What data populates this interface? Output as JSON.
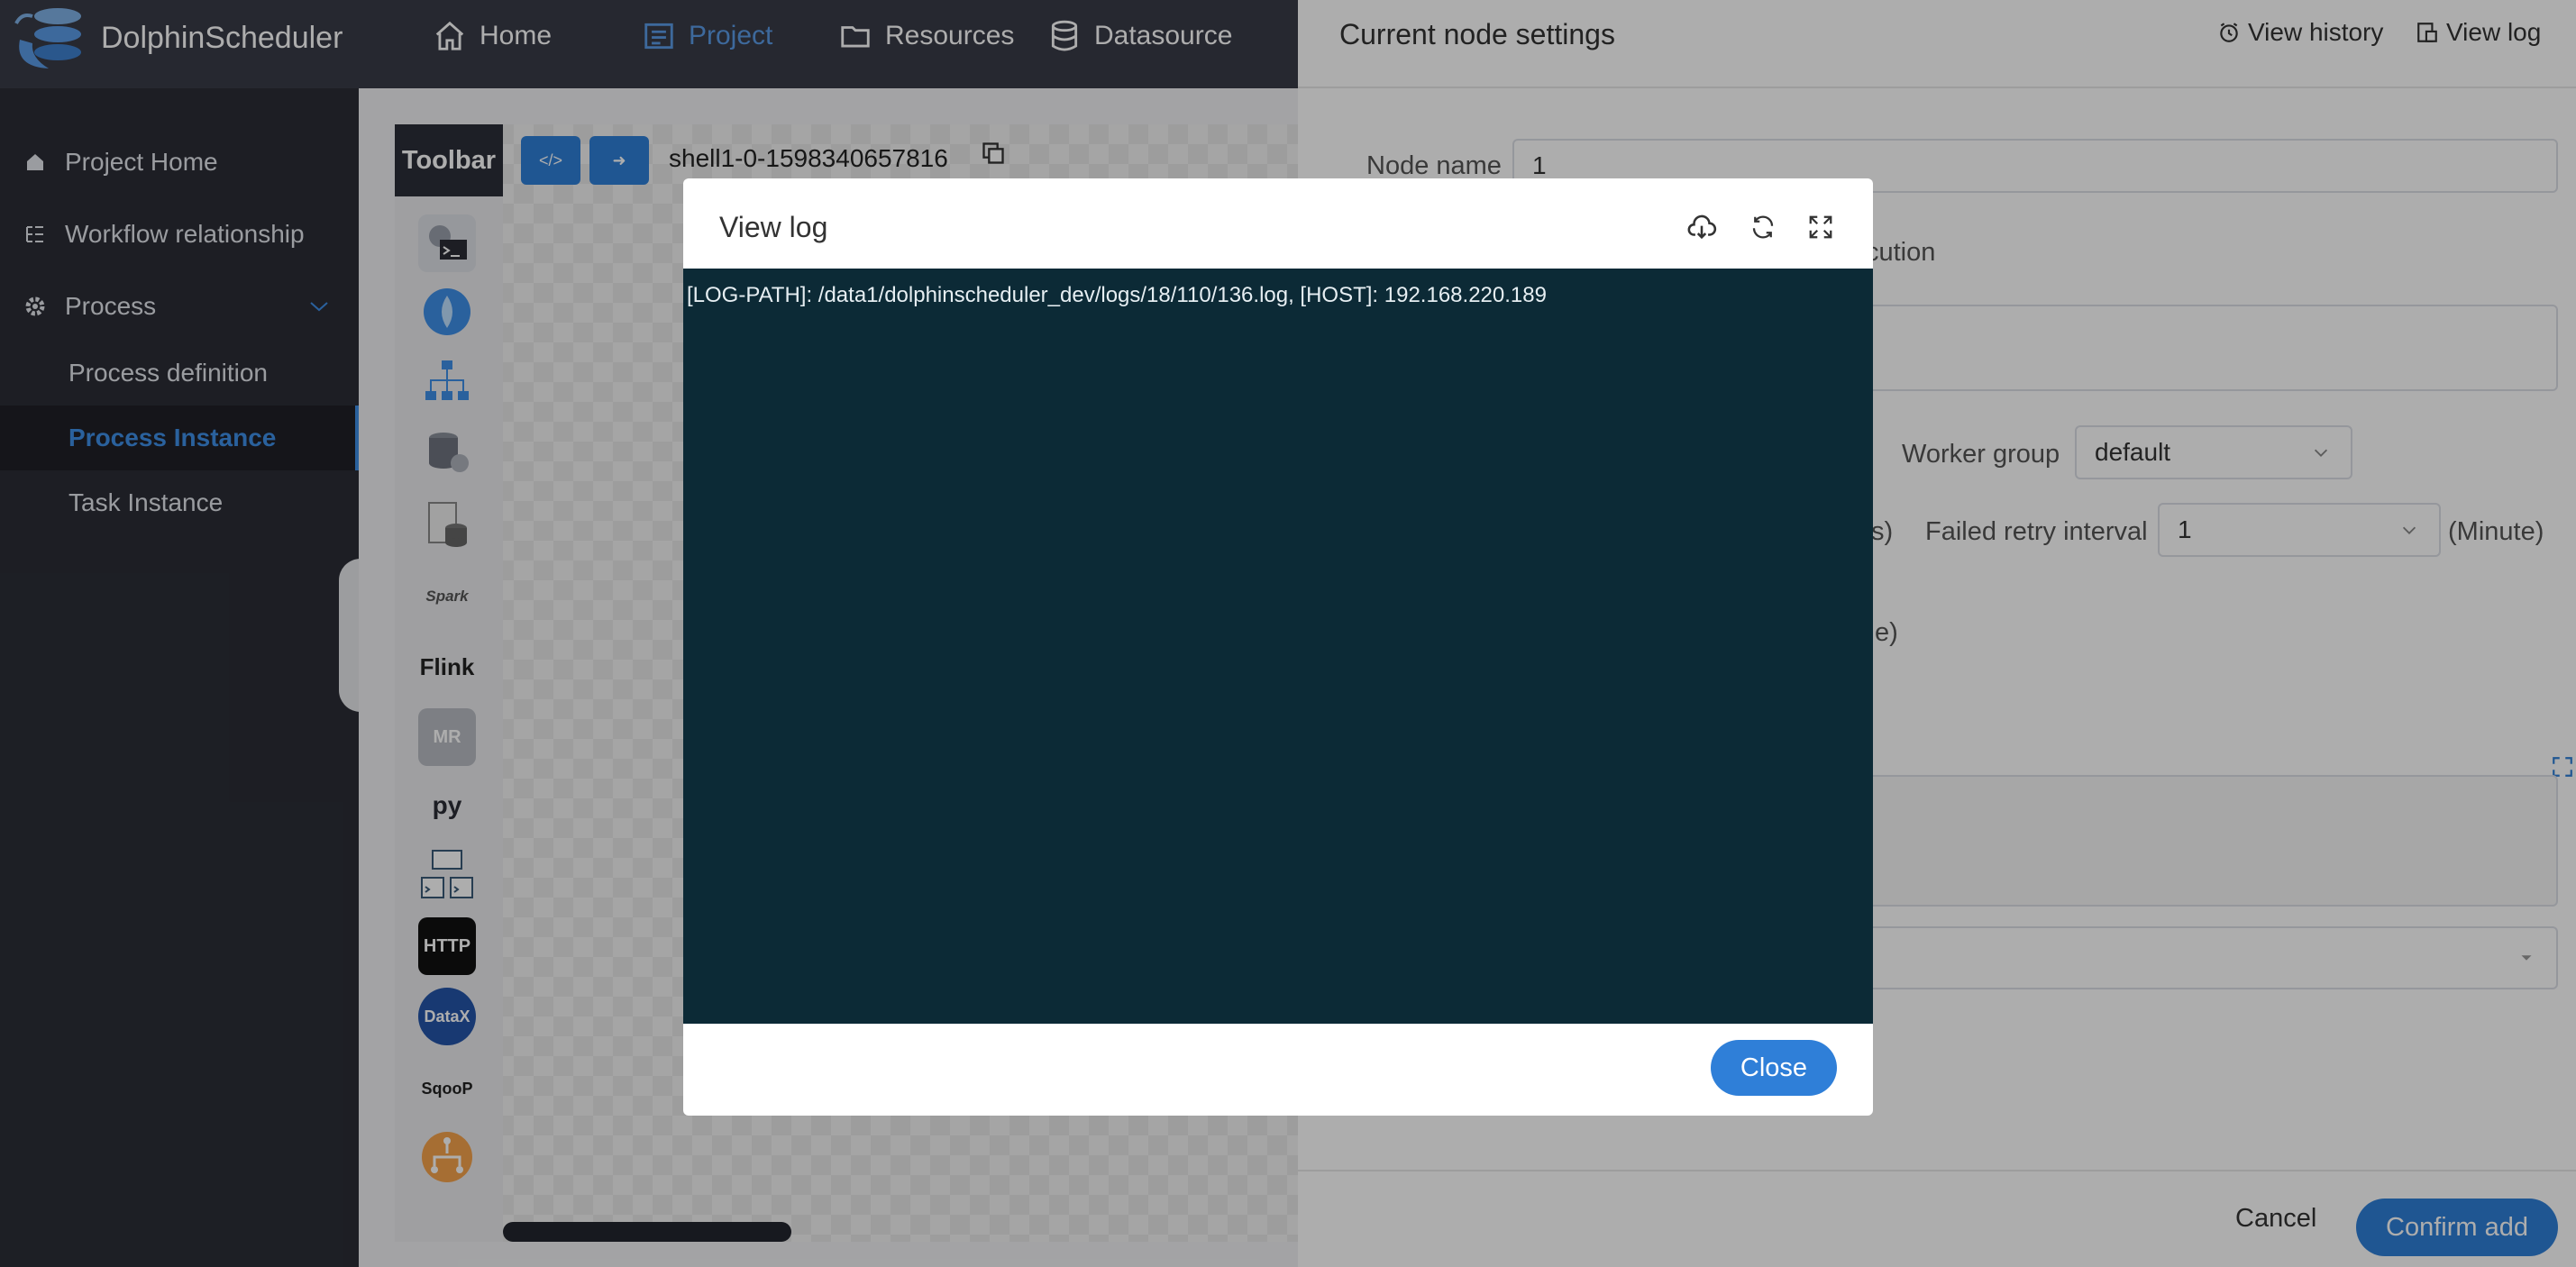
{
  "app": {
    "name": "DolphinScheduler"
  },
  "topnav": {
    "items": [
      {
        "label": "Home",
        "icon": "home-icon"
      },
      {
        "label": "Project",
        "icon": "project-icon",
        "active": true
      },
      {
        "label": "Resources",
        "icon": "folder-icon"
      },
      {
        "label": "Datasource",
        "icon": "database-icon"
      }
    ]
  },
  "sidebar": {
    "project_home": "Project Home",
    "workflow_relationship": "Workflow relationship",
    "process": "Process",
    "process_definition": "Process definition",
    "process_instance": "Process Instance",
    "task_instance": "Task Instance"
  },
  "dag": {
    "toolbar_label": "Toolbar",
    "process_name": "shell1-0-1598340657816",
    "tools": [
      {
        "name": "shell-icon"
      },
      {
        "name": "sub-process-icon"
      },
      {
        "name": "procedure-icon"
      },
      {
        "name": "sql-icon"
      },
      {
        "name": "stored-procedure-icon"
      },
      {
        "name": "spark-icon",
        "label": "Spark"
      },
      {
        "name": "flink-icon",
        "label": "Flink"
      },
      {
        "name": "mr-icon",
        "label": "MR"
      },
      {
        "name": "python-icon",
        "label": "py"
      },
      {
        "name": "dependent-icon"
      },
      {
        "name": "http-icon",
        "label": "HTTP"
      },
      {
        "name": "datax-icon",
        "label": "DataX"
      },
      {
        "name": "sqoop-icon",
        "label": "SqooP"
      },
      {
        "name": "conditions-icon"
      }
    ]
  },
  "drawer": {
    "title": "Current node settings",
    "view_history": "View history",
    "view_log": "View log",
    "node_name_label": "Node name",
    "node_name_value": "1",
    "partial_execution": "cution",
    "worker_group_label": "Worker group",
    "worker_group_value": "default",
    "retry_partial": "s)",
    "failed_retry_interval_label": "Failed retry interval",
    "failed_retry_interval_value": "1",
    "minute_unit": "(Minute)",
    "timeout_partial": "e)",
    "cancel": "Cancel",
    "confirm": "Confirm add"
  },
  "modal": {
    "title": "View log",
    "log_line": "[LOG-PATH]: /data1/dolphinscheduler_dev/logs/18/110/136.log, [HOST]:  192.168.220.189",
    "close": "Close"
  },
  "colors": {
    "accent": "#2f7fd8",
    "topbar": "#393b47",
    "sidebar": "#2b2d36",
    "log_bg": "#0c2a36"
  }
}
